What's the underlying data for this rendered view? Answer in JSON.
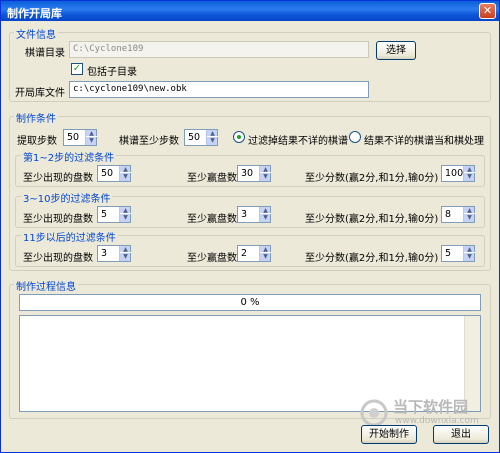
{
  "window": {
    "title": "制作开局库",
    "close_glyph": "✕"
  },
  "file_info": {
    "legend": "文件信息",
    "board_dir_label": "棋谱目录",
    "board_dir_value": "C:\\Cyclone109",
    "browse_label": "选择",
    "include_subdir_label": "包括子目录",
    "include_subdir_checked": true,
    "opening_file_label": "开局库文件",
    "opening_file_value": "c:\\cyclone109\\new.obk"
  },
  "conditions": {
    "legend": "制作条件",
    "extract_steps_label": "提取步数",
    "extract_steps_value": "50",
    "min_steps_label": "棋谱至少步数",
    "min_steps_value": "50",
    "radio_filter_label": "过滤掉结果不详的棋谱",
    "radio_draw_label": "结果不详的棋谱当和棋处理",
    "selected_radio": "filter",
    "groups": [
      {
        "legend": "第1~2步的过滤条件",
        "min_appear_label": "至少出现的盘数",
        "min_appear_value": "50",
        "min_wins_label": "至少赢盘数",
        "min_wins_value": "30",
        "min_score_label": "至少分数(赢2分,和1分,输0分)",
        "min_score_value": "100"
      },
      {
        "legend": "3~10步的过滤条件",
        "min_appear_label": "至少出现的盘数",
        "min_appear_value": "5",
        "min_wins_label": "至少赢盘数",
        "min_wins_value": "3",
        "min_score_label": "至少分数(赢2分,和1分,输0分)",
        "min_score_value": "8"
      },
      {
        "legend": "11步以后的过滤条件",
        "min_appear_label": "至少出现的盘数",
        "min_appear_value": "3",
        "min_wins_label": "至少赢盘数",
        "min_wins_value": "2",
        "min_score_label": "至少分数(赢2分,和1分,输0分)",
        "min_score_value": "5"
      }
    ]
  },
  "process": {
    "legend": "制作过程信息",
    "progress_text": "0 %",
    "progress_value": 0,
    "log_text": ""
  },
  "actions": {
    "start_label": "开始制作",
    "exit_label": "退出"
  },
  "watermark": {
    "brand": "当下软件园",
    "url": "www.downxia.com"
  },
  "colors": {
    "title_bar": "#0a5fd8",
    "accent_text": "#0046d5",
    "checkmark": "#21a121"
  }
}
